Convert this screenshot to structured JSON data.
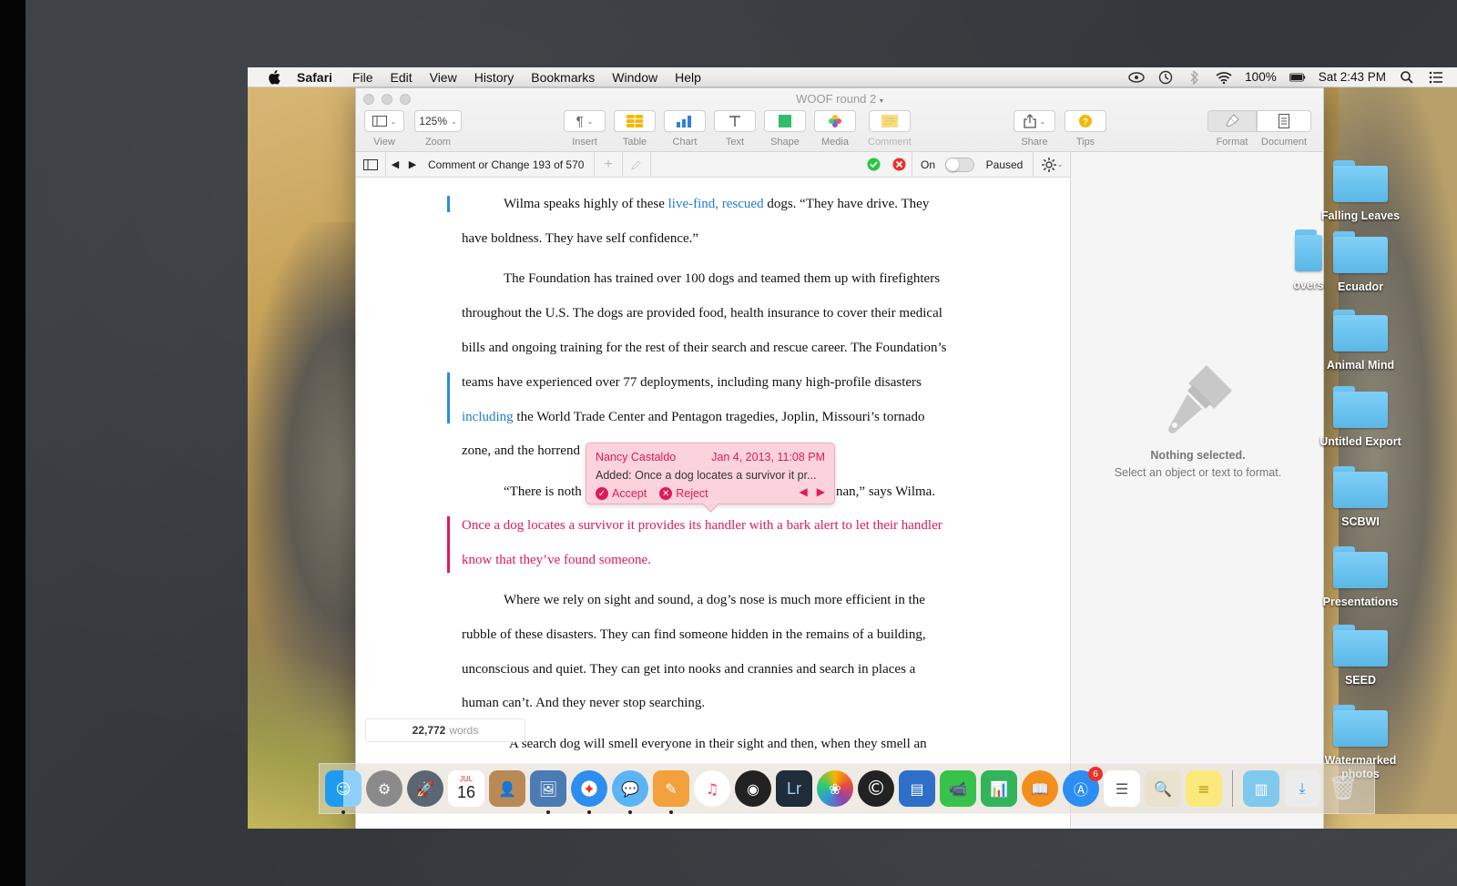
{
  "menubar": {
    "app": "Safari",
    "items": [
      "File",
      "Edit",
      "View",
      "History",
      "Bookmarks",
      "Window",
      "Help"
    ],
    "battery": "100%",
    "clock": "Sat 2:43 PM"
  },
  "window": {
    "title": "WOOF round 2",
    "toolbar": {
      "view_label": "View",
      "zoom_value": "125%",
      "zoom_label": "Zoom",
      "insert_label": "Insert",
      "table_label": "Table",
      "chart_label": "Chart",
      "text_label": "Text",
      "shape_label": "Shape",
      "media_label": "Media",
      "comment_label": "Comment",
      "share_label": "Share",
      "tips_label": "Tips",
      "format_label": "Format",
      "document_label": "Document"
    },
    "review": {
      "position": "Comment or Change 193 of 570",
      "tracking_on": "On",
      "paused": "Paused"
    }
  },
  "document": {
    "lines": [
      {
        "pre": "Wilma speaks highly of these ",
        "blue": "live-find, rescued",
        "post": " dogs. “They have drive. They"
      },
      {
        "text": "have boldness. They have self confidence.”"
      },
      {
        "text": "The Foundation has trained over 100 dogs and teamed them up with firefighters"
      },
      {
        "text": "throughout the U.S. The dogs are provided food, health insurance to cover their medical"
      },
      {
        "text": "bills and ongoing training for the rest of their search and rescue career. The Foundation’s"
      },
      {
        "text": "teams have experienced over 77 deployments, including many high-profile disasters"
      },
      {
        "blue": "including",
        "post": " the World Trade Center and Pentagon tragedies, Joplin, Missouri’s tornado"
      },
      {
        "text": "zone, and the horrend"
      },
      {
        "left": "“There is noth",
        "right": "nan,” says Wilma."
      },
      {
        "red": "Once a dog locates a survivor it provides its handler with a bark alert to let their handler"
      },
      {
        "red": "know that they’ve found someone."
      },
      {
        "text": "Where we rely on sight and sound, a dog’s nose is much more efficient in the"
      },
      {
        "text": "rubble of these disasters. They can find someone hidden in the remains of a building,"
      },
      {
        "text": "unconscious and quiet. They can get into nooks and crannies and search in places a"
      },
      {
        "text": "human can’t. And they never stop searching."
      },
      {
        "text": "A search dog will smell everyone in their sight and then, when they smell an"
      }
    ],
    "word_count": "22,772",
    "word_label": "words"
  },
  "popover": {
    "author": "Nancy Castaldo",
    "date": "Jan 4, 2013, 11:08 PM",
    "text": "Added: Once a dog locates a survivor it pr...",
    "accept": "Accept",
    "reject": "Reject"
  },
  "inspector": {
    "title": "Nothing selected.",
    "subtitle": "Select an object or text to format."
  },
  "desktop": {
    "items": [
      "Falling Leaves",
      "Ecuador",
      "Animal Mind",
      "Untitled Export",
      "SCBWI",
      "Presentations",
      "SEED",
      "Watermarked photos"
    ],
    "partial_label": "overs"
  },
  "dock": {
    "calendar_month": "JUL",
    "calendar_day": "16",
    "lightroom": "Lr",
    "appstore_badge": "6"
  },
  "colors": {
    "accent_blue": "#1f7bd0",
    "change_red": "#e0195a",
    "popover_bg": "#fbd3dd"
  }
}
